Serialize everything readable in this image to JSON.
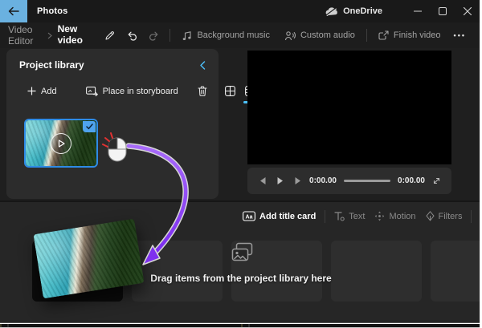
{
  "titlebar": {
    "app_title": "Photos",
    "onedrive_label": "OneDrive"
  },
  "commandbar": {
    "breadcrumb_root": "Video Editor",
    "breadcrumb_current": "New video",
    "background_music_label": "Background music",
    "custom_audio_label": "Custom audio",
    "finish_video_label": "Finish video"
  },
  "project_library": {
    "title": "Project library",
    "add_label": "Add",
    "place_in_storyboard_label": "Place in storyboard"
  },
  "player": {
    "elapsed": "0:00.00",
    "duration": "0:00.00"
  },
  "storyboard": {
    "add_title_card_label": "Add title card",
    "text_label": "Text",
    "motion_label": "Motion",
    "filters_label": "Filters",
    "drop_hint": "Drag items from the project library here"
  },
  "icons": {
    "more_dots": "•••",
    "title_card_glyph": "Aa"
  },
  "colors": {
    "accent_blue": "#4cc2ff",
    "breadcrumb_underline": "#35a3f1",
    "selection_border_blue": "#2e8be6",
    "drag_arrow_purple": "#8b3df2",
    "back_button_highlight": "#6ab1e0"
  }
}
